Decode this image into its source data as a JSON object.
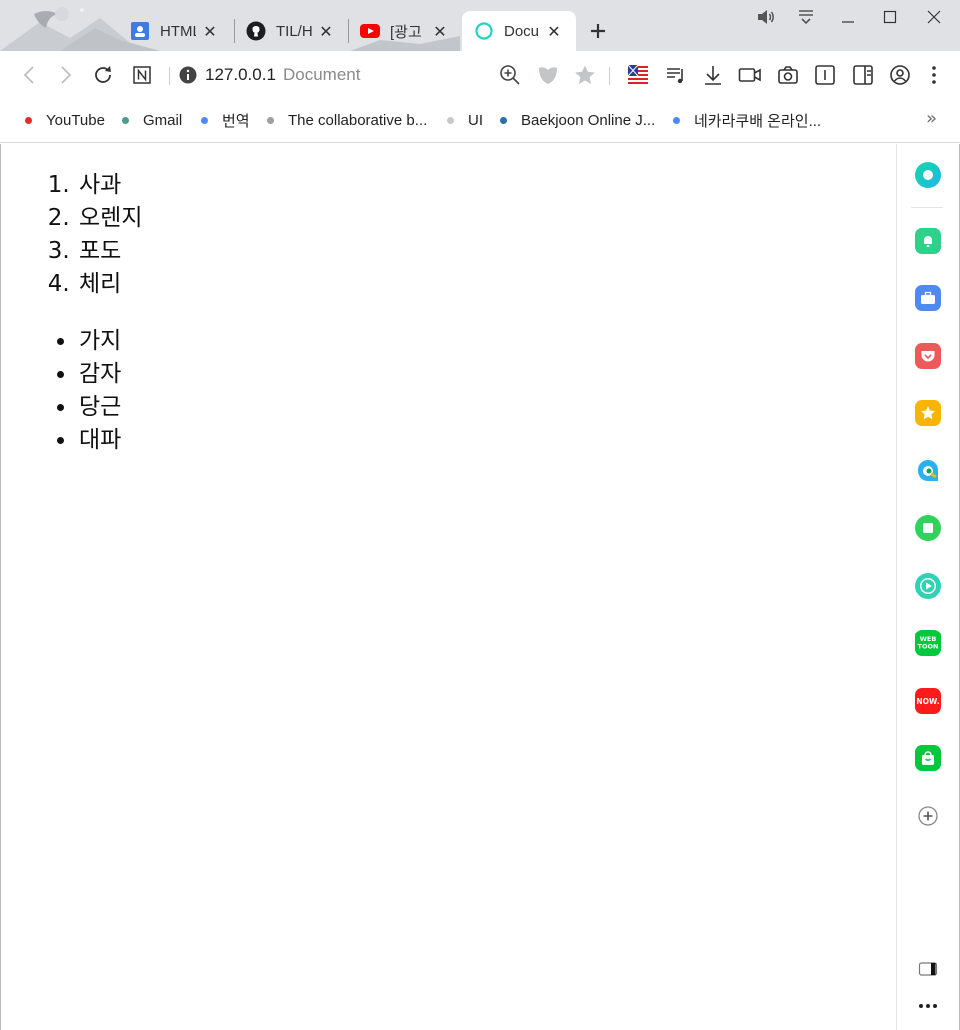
{
  "tabs": [
    {
      "title": "HTML",
      "icon": "contacts-blue-icon"
    },
    {
      "title": "TIL/H",
      "icon": "github-icon"
    },
    {
      "title": "[광고",
      "icon": "youtube-icon"
    },
    {
      "title": "Docu",
      "icon": "loading-ring-icon",
      "active": true
    }
  ],
  "address": {
    "host": "127.0.0.1",
    "page_title": "Document"
  },
  "bookmarks": [
    {
      "label": "YouTube",
      "color": "#e52d27"
    },
    {
      "label": "Gmail",
      "color": "#4a9c8e"
    },
    {
      "label": "번역",
      "color": "#4a8af4"
    },
    {
      "label": "The collaborative b...",
      "color": "#9e9e9e"
    },
    {
      "label": "UI",
      "color": "#c8c8c8"
    },
    {
      "label": "Baekjoon Online J...",
      "color": "#2b6ea8"
    },
    {
      "label": "네카라쿠배 온라인...",
      "color": "#4a8af4"
    }
  ],
  "content": {
    "ordered_list": [
      "사과",
      "오렌지",
      "포도",
      "체리"
    ],
    "unordered_list": [
      "가지",
      "감자",
      "당근",
      "대파"
    ]
  },
  "side_panel": [
    {
      "name": "whale-home-icon",
      "color": "#1ecf9c"
    },
    {
      "name": "notification-bell-icon",
      "color": "#2ed08a"
    },
    {
      "name": "briefcase-icon",
      "color": "#4f8af2"
    },
    {
      "name": "pocket-icon",
      "color": "#ee5a5a"
    },
    {
      "name": "star-bookmark-icon",
      "color": "#f7b500"
    },
    {
      "name": "papago-translate-icon",
      "color": "#2bb1f0"
    },
    {
      "name": "memo-icon",
      "color": "#2fd25a"
    },
    {
      "name": "media-play-icon",
      "color": "#2fd2b4"
    },
    {
      "name": "webtoon-icon",
      "color": "#00c73c"
    },
    {
      "name": "now-icon",
      "color": "#ff1b1b"
    },
    {
      "name": "shopping-bag-icon",
      "color": "#00c73c"
    }
  ],
  "side_panel_badges": {
    "webtoon": "WEB TOON",
    "now": "NOW."
  }
}
